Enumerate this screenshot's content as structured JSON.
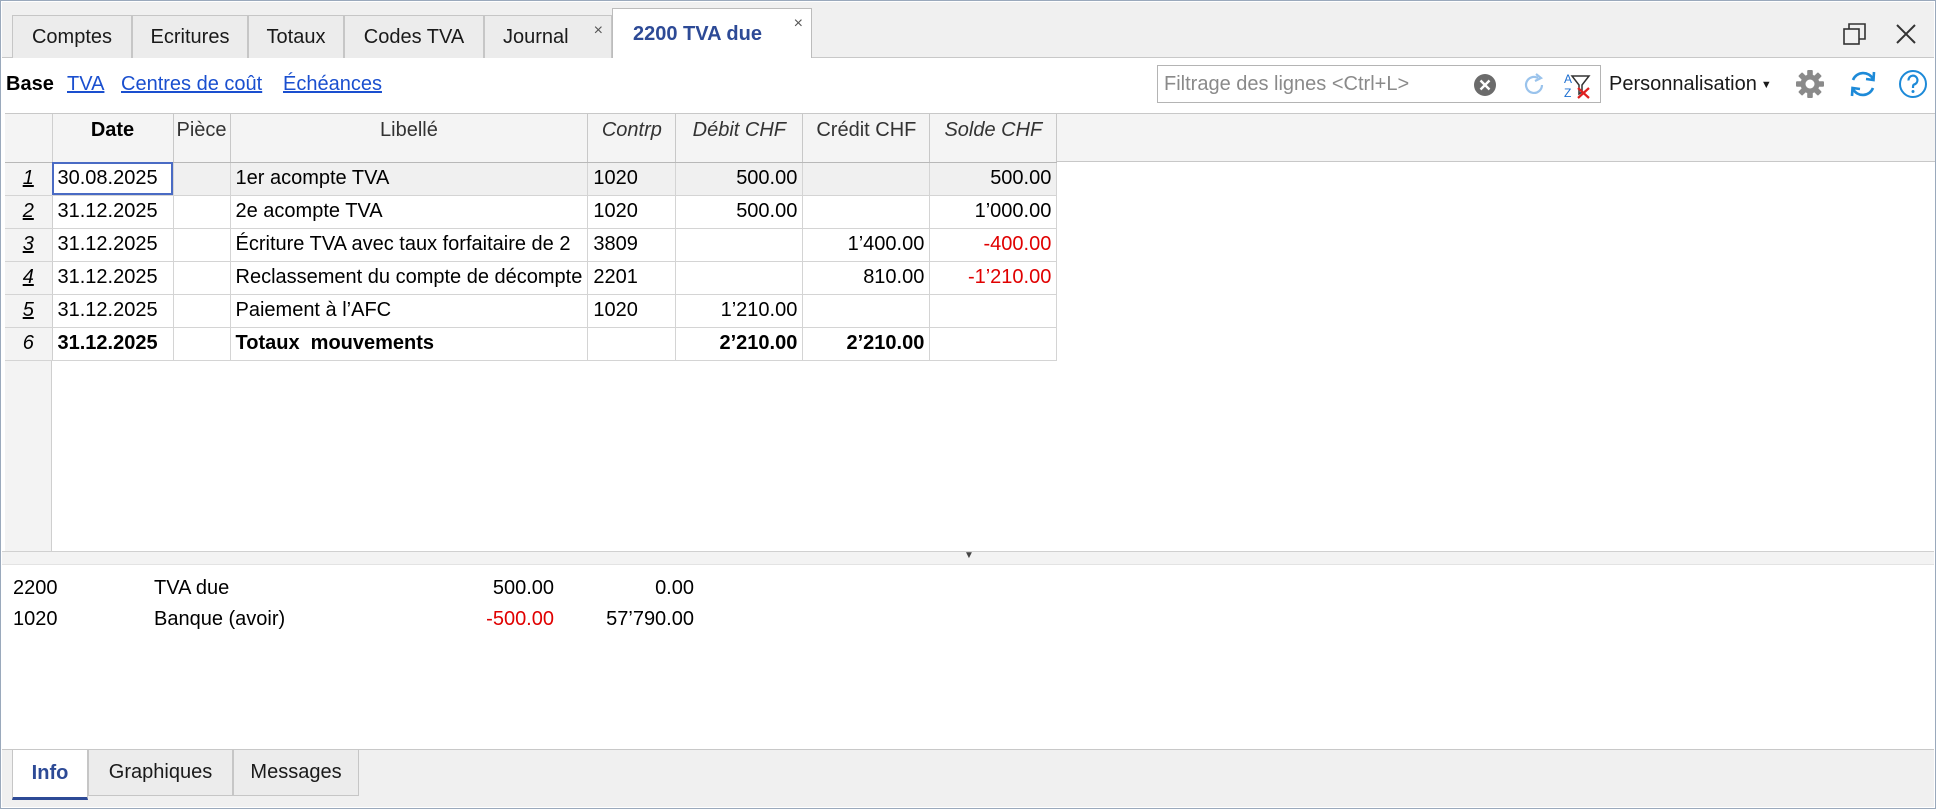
{
  "tabs": [
    {
      "label": "Comptes",
      "active": false,
      "closable": false
    },
    {
      "label": "Ecritures",
      "active": false,
      "closable": false
    },
    {
      "label": "Totaux",
      "active": false,
      "closable": false
    },
    {
      "label": "Codes TVA",
      "active": false,
      "closable": false
    },
    {
      "label": "Journal",
      "active": false,
      "closable": true
    },
    {
      "label": "2200 TVA due",
      "active": true,
      "closable": true
    }
  ],
  "tab_close_glyph": "×",
  "views": {
    "base": "Base",
    "links": [
      "TVA",
      "Centres de coût",
      "Échéances"
    ]
  },
  "filter": {
    "placeholder": "Filtrage des lignes <Ctrl+L>",
    "value": ""
  },
  "personalisation_label": "Personnalisation",
  "columns": [
    "Date",
    "Pièce",
    "Libellé",
    "Contrp",
    "Débit CHF",
    "Crédit CHF",
    "Solde CHF"
  ],
  "rows": [
    {
      "num": "1",
      "date": "30.08.2025",
      "piece": "",
      "libelle": "1er acompte TVA",
      "contrp": "1020",
      "debit": "500.00",
      "credit": "",
      "solde": "500.00",
      "solde_negative": false
    },
    {
      "num": "2",
      "date": "31.12.2025",
      "piece": "",
      "libelle": "2e acompte TVA",
      "contrp": "1020",
      "debit": "500.00",
      "credit": "",
      "solde": "1’000.00",
      "solde_negative": false
    },
    {
      "num": "3",
      "date": "31.12.2025",
      "piece": "",
      "libelle": "Écriture TVA avec taux forfaitaire de 2",
      "contrp": "3809",
      "debit": "",
      "credit": "1’400.00",
      "solde": "-400.00",
      "solde_negative": true
    },
    {
      "num": "4",
      "date": "31.12.2025",
      "piece": "",
      "libelle": "Reclassement du compte de décompte",
      "contrp": "2201",
      "debit": "",
      "credit": "810.00",
      "solde": "-1’210.00",
      "solde_negative": true
    },
    {
      "num": "5",
      "date": "31.12.2025",
      "piece": "",
      "libelle": "Paiement à l’AFC",
      "contrp": "1020",
      "debit": "1’210.00",
      "credit": "",
      "solde": "",
      "solde_negative": false
    }
  ],
  "total_row": {
    "num": "6",
    "date": "31.12.2025",
    "piece": "",
    "libelle": "Totaux  mouvements",
    "contrp": "",
    "debit": "2’210.00",
    "credit": "2’210.00",
    "solde": ""
  },
  "info": [
    {
      "account": "2200",
      "description": "TVA due",
      "value1": "500.00",
      "value1_negative": false,
      "value2": "0.00"
    },
    {
      "account": "1020",
      "description": "Banque (avoir)",
      "value1": "-500.00",
      "value1_negative": true,
      "value2": "57’790.00"
    }
  ],
  "bottom_tabs": [
    {
      "label": "Info",
      "active": true
    },
    {
      "label": "Graphiques",
      "active": false
    },
    {
      "label": "Messages",
      "active": false
    }
  ],
  "colors": {
    "accent": "#2d4a96",
    "link": "#1a4fcf",
    "negative": "#e00000"
  }
}
